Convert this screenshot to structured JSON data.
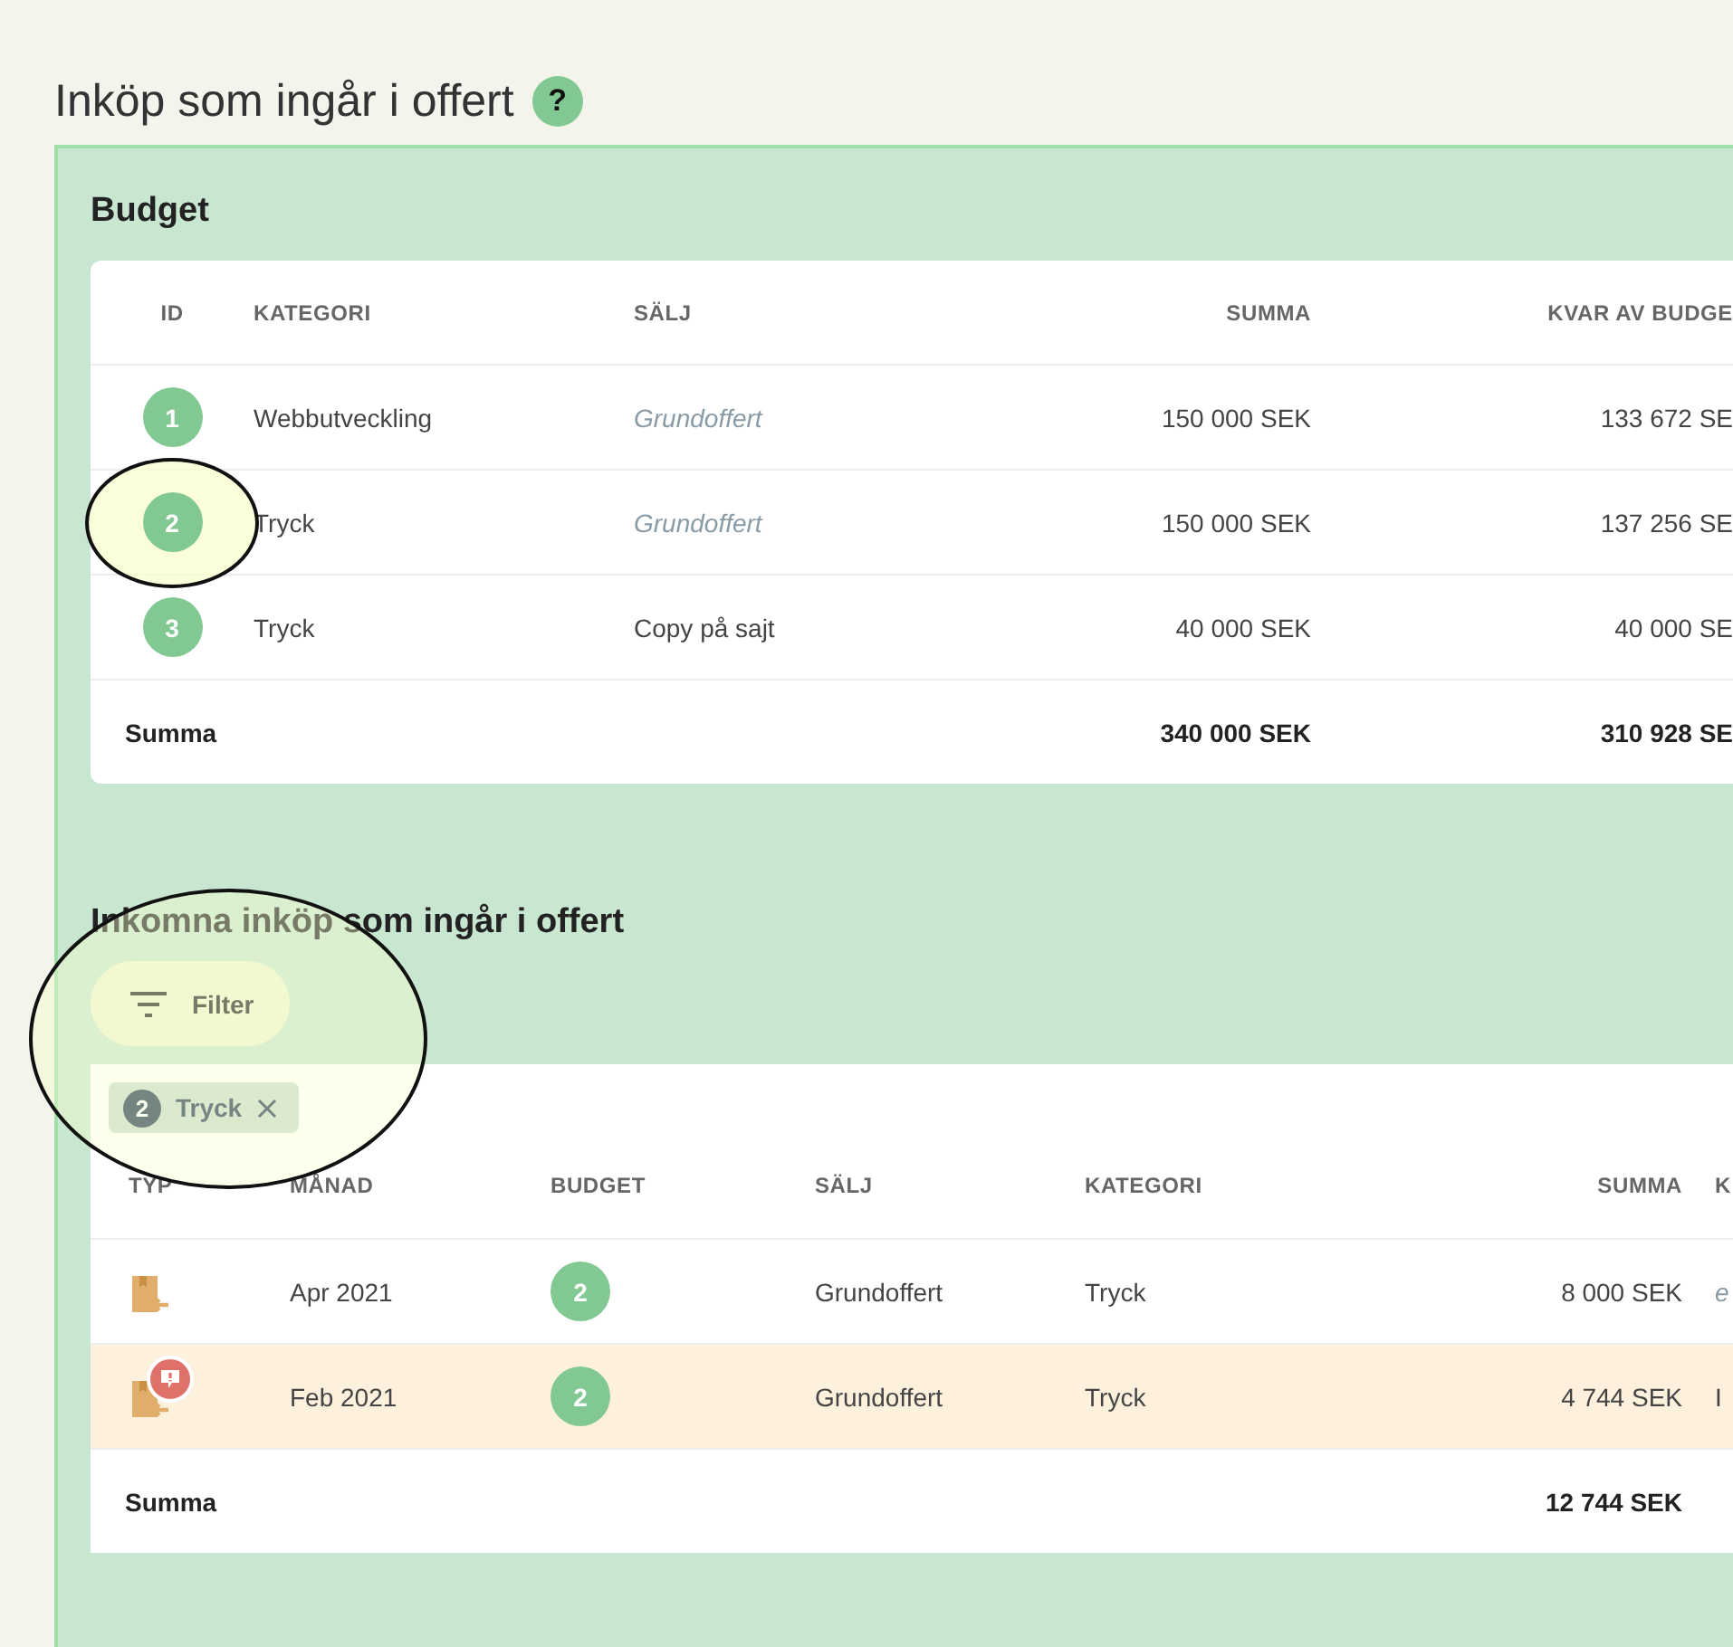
{
  "page": {
    "title": "Inköp som ingår i offert",
    "help": "?"
  },
  "budget": {
    "title": "Budget",
    "columns": [
      "ID",
      "KATEGORI",
      "SÄLJ",
      "SUMMA",
      "KVAR AV BUDGE"
    ],
    "rows": [
      {
        "id": "1",
        "category": "Webbutveckling",
        "sale": "Grundoffert",
        "sale_default": true,
        "sum": "150 000 SEK",
        "remaining": "133 672 SE",
        "highlighted": false
      },
      {
        "id": "2",
        "category": "Tryck",
        "sale": "Grundoffert",
        "sale_default": true,
        "sum": "150 000 SEK",
        "remaining": "137 256 SE",
        "highlighted": true
      },
      {
        "id": "3",
        "category": "Tryck",
        "sale": "Copy på sajt",
        "sale_default": false,
        "sum": "40 000 SEK",
        "remaining": "40 000 SE",
        "highlighted": false
      }
    ],
    "total": {
      "label": "Summa",
      "sum": "340 000 SEK",
      "remaining": "310 928 SE"
    }
  },
  "purchases": {
    "title": "Inkomna inköp som ingår i offert",
    "filter_button": "Filter",
    "filter_highlighted": true,
    "chips": [
      {
        "count": "2",
        "label": "Tryck"
      }
    ],
    "columns": [
      "TYP",
      "MÅNAD",
      "BUDGET",
      "SÄLJ",
      "KATEGORI",
      "SUMMA",
      "K"
    ],
    "rows": [
      {
        "alert": false,
        "month": "Apr 2021",
        "budget": "2",
        "sale": "Grundoffert",
        "category": "Tryck",
        "sum": "8 000 SEK",
        "column_7": "e",
        "column_7_muted": true,
        "highlighted": false
      },
      {
        "alert": true,
        "month": "Feb 2021",
        "budget": "2",
        "sale": "Grundoffert",
        "category": "Tryck",
        "sum": "4 744 SEK",
        "column_7": "I",
        "column_7_muted": false,
        "highlighted": true
      }
    ],
    "total": {
      "label": "Summa",
      "sum": "12 744 SEK"
    }
  }
}
